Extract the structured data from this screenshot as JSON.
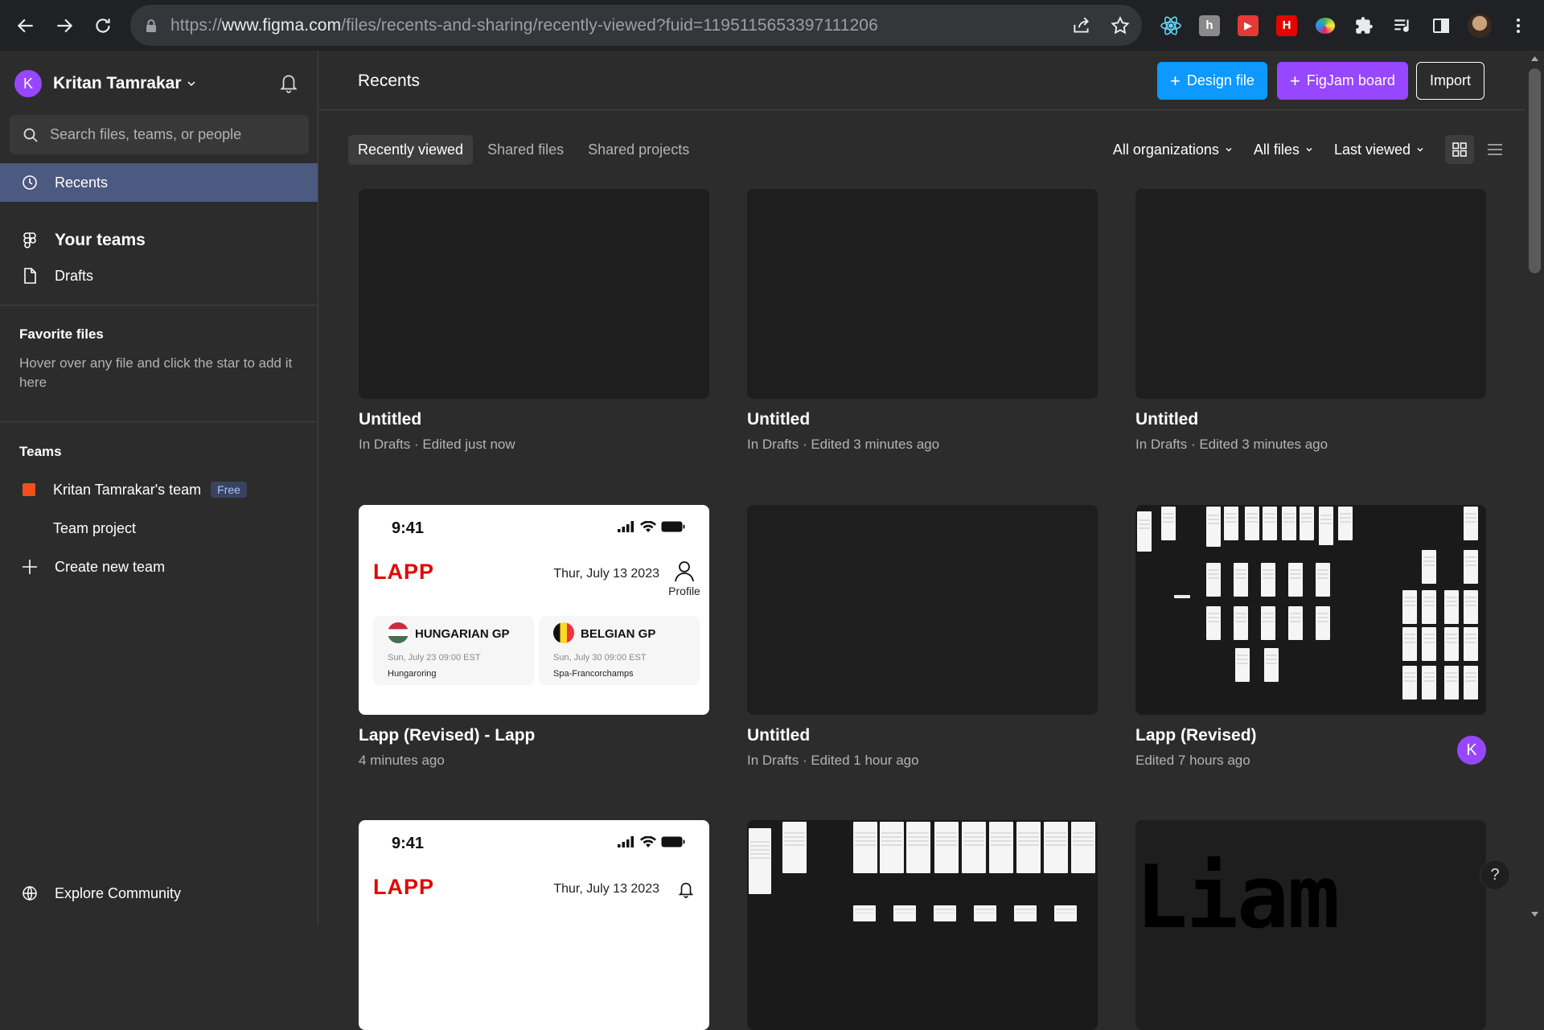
{
  "browser": {
    "url_prefix": "https://",
    "url_host": "www.figma.com",
    "url_path": "/files/recents-and-sharing/recently-viewed?fuid=1195115653397111206",
    "extensions": [
      "react-devtools-icon",
      "h-icon",
      "youtube-red-icon",
      "h-red-icon",
      "colorful-icon",
      "puzzle-icon",
      "media-icon",
      "sidepanel-icon"
    ]
  },
  "sidebar": {
    "user_initial": "K",
    "user_name": "Kritan Tamrakar",
    "search_placeholder": "Search files, teams, or people",
    "nav": {
      "recents": "Recents",
      "your_teams": "Your teams",
      "drafts": "Drafts"
    },
    "favorites": {
      "title": "Favorite files",
      "hint": "Hover over any file and click the star to add it here"
    },
    "teams": {
      "title": "Teams",
      "team_name": "Kritan Tamrakar's team",
      "badge": "Free",
      "project": "Team project",
      "create": "Create new team"
    },
    "explore": "Explore Community"
  },
  "main": {
    "title": "Recents",
    "buttons": {
      "design_file": "Design file",
      "figjam_board": "FigJam board",
      "import": "Import"
    },
    "tabs": [
      "Recently viewed",
      "Shared files",
      "Shared projects"
    ],
    "filters": {
      "org": "All organizations",
      "files": "All files",
      "sort": "Last viewed"
    },
    "files": [
      {
        "title": "Untitled",
        "subtitle": "In Drafts · Edited just now"
      },
      {
        "title": "Untitled",
        "subtitle": "In Drafts · Edited 3 minutes ago"
      },
      {
        "title": "Untitled",
        "subtitle": "In Drafts · Edited 3 minutes ago"
      },
      {
        "title": "Lapp (Revised) - Lapp",
        "subtitle": "4 minutes ago"
      },
      {
        "title": "Untitled",
        "subtitle": "In Drafts · Edited 1 hour ago"
      },
      {
        "title": "Lapp (Revised)",
        "subtitle": "Edited 7 hours ago",
        "avatar": "K"
      }
    ],
    "lapp_thumb": {
      "time": "9:41",
      "logo": "LAPP",
      "date": "Thur, July 13 2023",
      "profile": "Profile",
      "gp1_name": "HUNGARIAN GP",
      "gp1_time": "Sun, July 23   09:00 EST",
      "gp1_track": "Hungaroring",
      "gp2_name": "BELGIAN GP",
      "gp2_time": "Sun, July 30   09:00 EST",
      "gp2_track": "Spa-Francorchamps"
    },
    "liam_text": "Liam",
    "help": "?"
  }
}
